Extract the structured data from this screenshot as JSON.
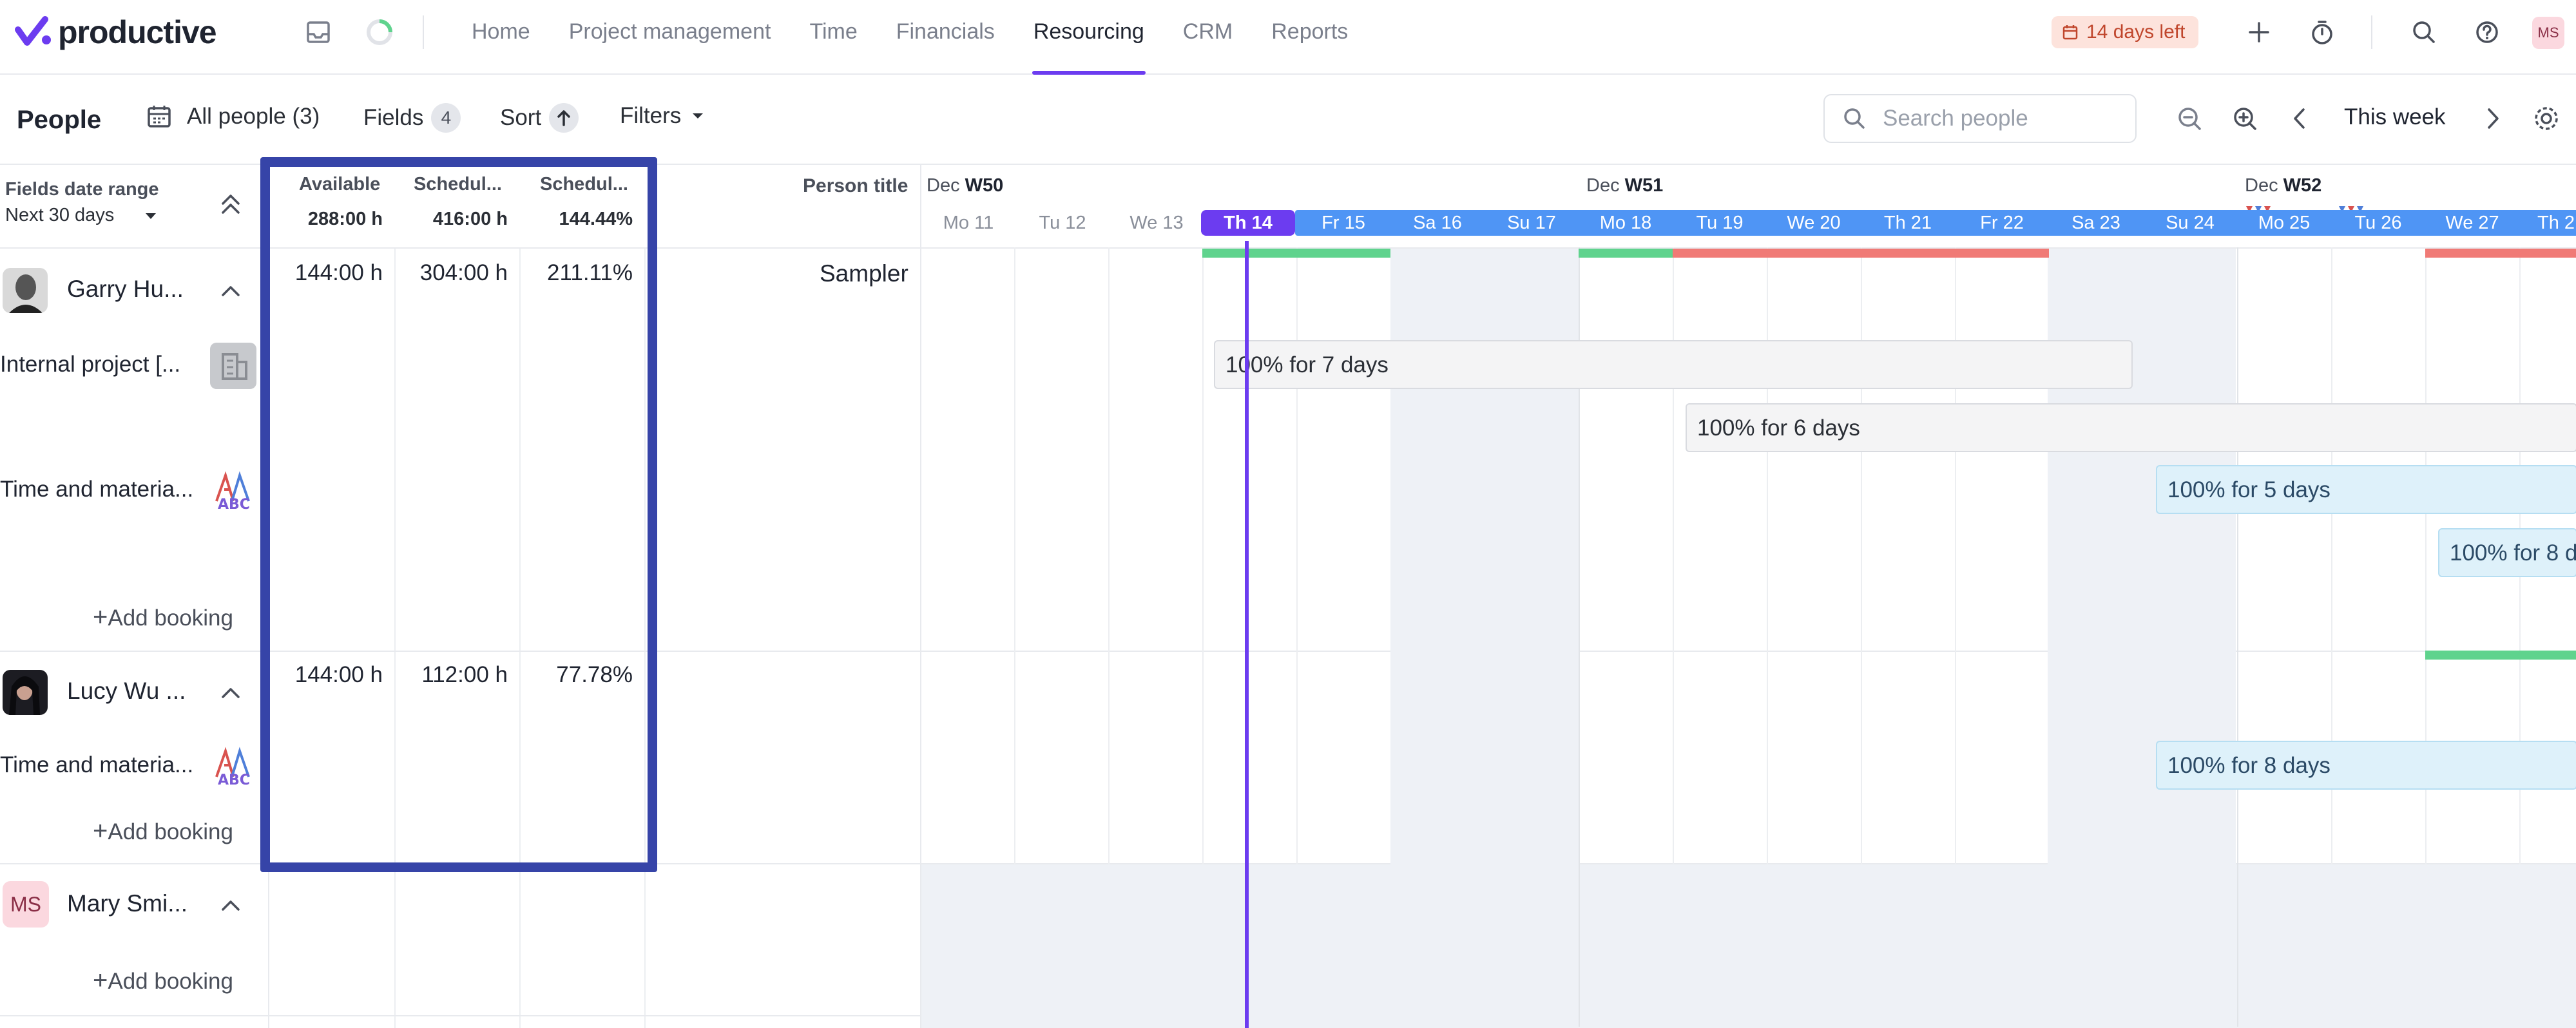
{
  "app": {
    "name": "productive"
  },
  "nav": {
    "items": [
      "Home",
      "Project management",
      "Time",
      "Financials",
      "Resourcing",
      "CRM",
      "Reports"
    ],
    "active": "Resourcing"
  },
  "trial": {
    "label": "14 days left"
  },
  "user": {
    "initials": "MS"
  },
  "toolbar": {
    "title": "People",
    "all_people": "All people (3)",
    "fields_label": "Fields",
    "fields_count": "4",
    "sort_label": "Sort",
    "filters_label": "Filters",
    "search_placeholder": "Search people",
    "period": "This week"
  },
  "fields_date_range": {
    "title": "Fields date range",
    "value": "Next 30 days"
  },
  "fields": {
    "columns": [
      {
        "label": "Available",
        "total": "288:00 h"
      },
      {
        "label": "Schedul...",
        "total": "416:00 h"
      },
      {
        "label": "Schedul...",
        "total": "144.44%"
      }
    ],
    "person_title_header": "Person title"
  },
  "people": [
    {
      "name": "Garry Hu...",
      "title": "Sampler",
      "values": [
        "144:00 h",
        "304:00 h",
        "211.11%"
      ],
      "projects": [
        {
          "name": "Internal project [..."
        },
        {
          "name": "Time and materia..."
        }
      ],
      "add_booking": "Add booking"
    },
    {
      "name": "Lucy Wu ...",
      "title": "",
      "values": [
        "144:00 h",
        "112:00 h",
        "77.78%"
      ],
      "projects": [
        {
          "name": "Time and materia..."
        }
      ],
      "add_booking": "Add booking"
    },
    {
      "name": "Mary Smi...",
      "initials": "MS",
      "add_booking": "Add booking"
    }
  ],
  "timeline": {
    "weeks": [
      {
        "month": "Dec",
        "week": "W50"
      },
      {
        "month": "Dec",
        "week": "W51"
      },
      {
        "month": "Dec",
        "week": "W52"
      }
    ],
    "days": [
      "Mo 11",
      "Tu 12",
      "We 13",
      "Th 14",
      "Fr 15",
      "Sa 16",
      "Su 17",
      "Mo 18",
      "Tu 19",
      "We 20",
      "Th 21",
      "Fr 22",
      "Sa 23",
      "Su 24",
      "Mo 25",
      "Tu 26",
      "We 27",
      "Th 2"
    ],
    "today": "Th 14",
    "bookings": [
      "100% for 7 days",
      "100% for 6 days",
      "100% for 5 days",
      "100% for 8 d",
      "100% for 8 days"
    ]
  },
  "colors": {
    "accent": "#6c3cf0",
    "overbooked": "#f07a76",
    "available": "#5fd38d",
    "day_strip": "#4f95f5",
    "highlight": "#3644a8"
  }
}
